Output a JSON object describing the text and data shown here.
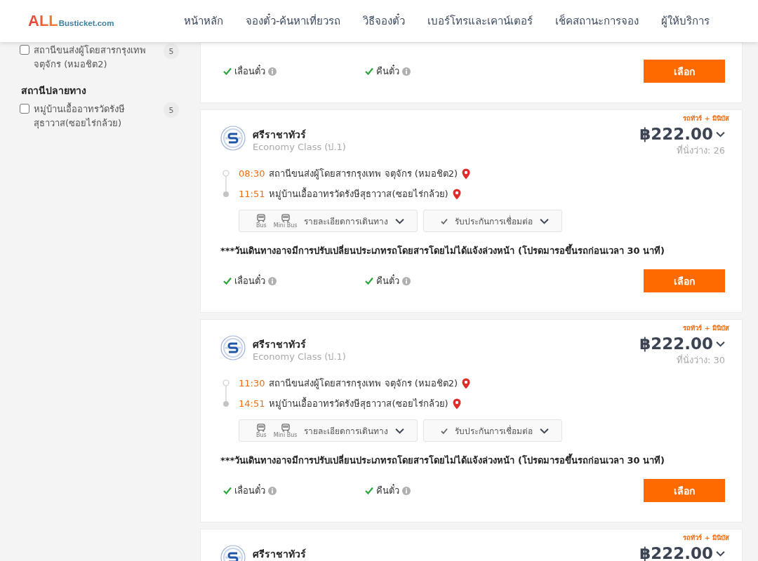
{
  "header": {
    "logo": {
      "brand": "ALL",
      "domain": "Busticket.com"
    },
    "nav": [
      {
        "label": "หน้าหลัก"
      },
      {
        "label": "จองตั๋ว-ค้นหาเที่ยวรถ"
      },
      {
        "label": "วิธีจองตั๋ว"
      },
      {
        "label": "เบอร์โทรและเคาน์เตอร์"
      },
      {
        "label": "เช็คสถานะการจอง"
      },
      {
        "label": "ผู้ให้บริการ"
      }
    ]
  },
  "sidebar": {
    "sections": [
      {
        "items": [
          {
            "label": "สถานีขนส่งผู้โดยสารกรุงเทพ จตุจักร (หมอชิต2)",
            "count": "5",
            "checked": false
          }
        ]
      },
      {
        "title": "สถานีปลายทาง",
        "items": [
          {
            "label": "หมู่บ้านเอื้ออาทรวัดรังษีสุธาวาส(ซอยไร่กล้วย)",
            "count": "5",
            "checked": false
          }
        ]
      }
    ]
  },
  "trips": [
    {
      "features": [
        {
          "label": "เลื่อนตั๋ว",
          "available": true
        },
        {
          "label": "คืนตั๋ว",
          "available": true
        }
      ],
      "select_label": "เลือก"
    },
    {
      "tag": "รถทัวร์ + มินิบัส",
      "operator": "ศรีราชาทัวร์",
      "class": "Economy Class (ป.1)",
      "price": "฿222.00",
      "seats": "ที่นั่งว่าง: 26",
      "stops": [
        {
          "time": "08:30",
          "place": "สถานีขนส่งผู้โดยสารกรุงเทพ จตุจักร (หมอชิต2)"
        },
        {
          "time": "11:51",
          "place": "หมู่บ้านเอื้ออาทรวัดรังษีสุธาวาส(ซอยไร่กล้วย)"
        }
      ],
      "vehicles": [
        {
          "label": "Bus"
        },
        {
          "label": "Mini Bus"
        }
      ],
      "details_label": "รายละเอียดการเดินทาง",
      "guarantee_label": "รับประกันการเชื่อมต่อ",
      "note": "***วันเดินทางอาจมีการปรับเปลี่ยนประเภทรถโดยสารโดยไม่ได้แจ้งล่วงหน้า (โปรดมารอขึ้นรถก่อนเวลา 30 นาที)",
      "features": [
        {
          "label": "เลื่อนตั๋ว",
          "available": true
        },
        {
          "label": "คืนตั๋ว",
          "available": true
        }
      ],
      "select_label": "เลือก"
    },
    {
      "tag": "รถทัวร์ + มินิบัส",
      "operator": "ศรีราชาทัวร์",
      "class": "Economy Class (ป.1)",
      "price": "฿222.00",
      "seats": "ที่นั่งว่าง: 30",
      "stops": [
        {
          "time": "11:30",
          "place": "สถานีขนส่งผู้โดยสารกรุงเทพ จตุจักร (หมอชิต2)"
        },
        {
          "time": "14:51",
          "place": "หมู่บ้านเอื้ออาทรวัดรังษีสุธาวาส(ซอยไร่กล้วย)"
        }
      ],
      "vehicles": [
        {
          "label": "Bus"
        },
        {
          "label": "Mini Bus"
        }
      ],
      "details_label": "รายละเอียดการเดินทาง",
      "guarantee_label": "รับประกันการเชื่อมต่อ",
      "note": "***วันเดินทางอาจมีการปรับเปลี่ยนประเภทรถโดยสารโดยไม่ได้แจ้งล่วงหน้า (โปรดมารอขึ้นรถก่อนเวลา 30 นาที)",
      "features": [
        {
          "label": "เลื่อนตั๋ว",
          "available": true
        },
        {
          "label": "คืนตั๋ว",
          "available": true
        }
      ],
      "select_label": "เลือก"
    },
    {
      "tag": "รถทัวร์ + มินิบัส",
      "operator": "ศรีราชาทัวร์",
      "price": "฿222.00"
    }
  ]
}
